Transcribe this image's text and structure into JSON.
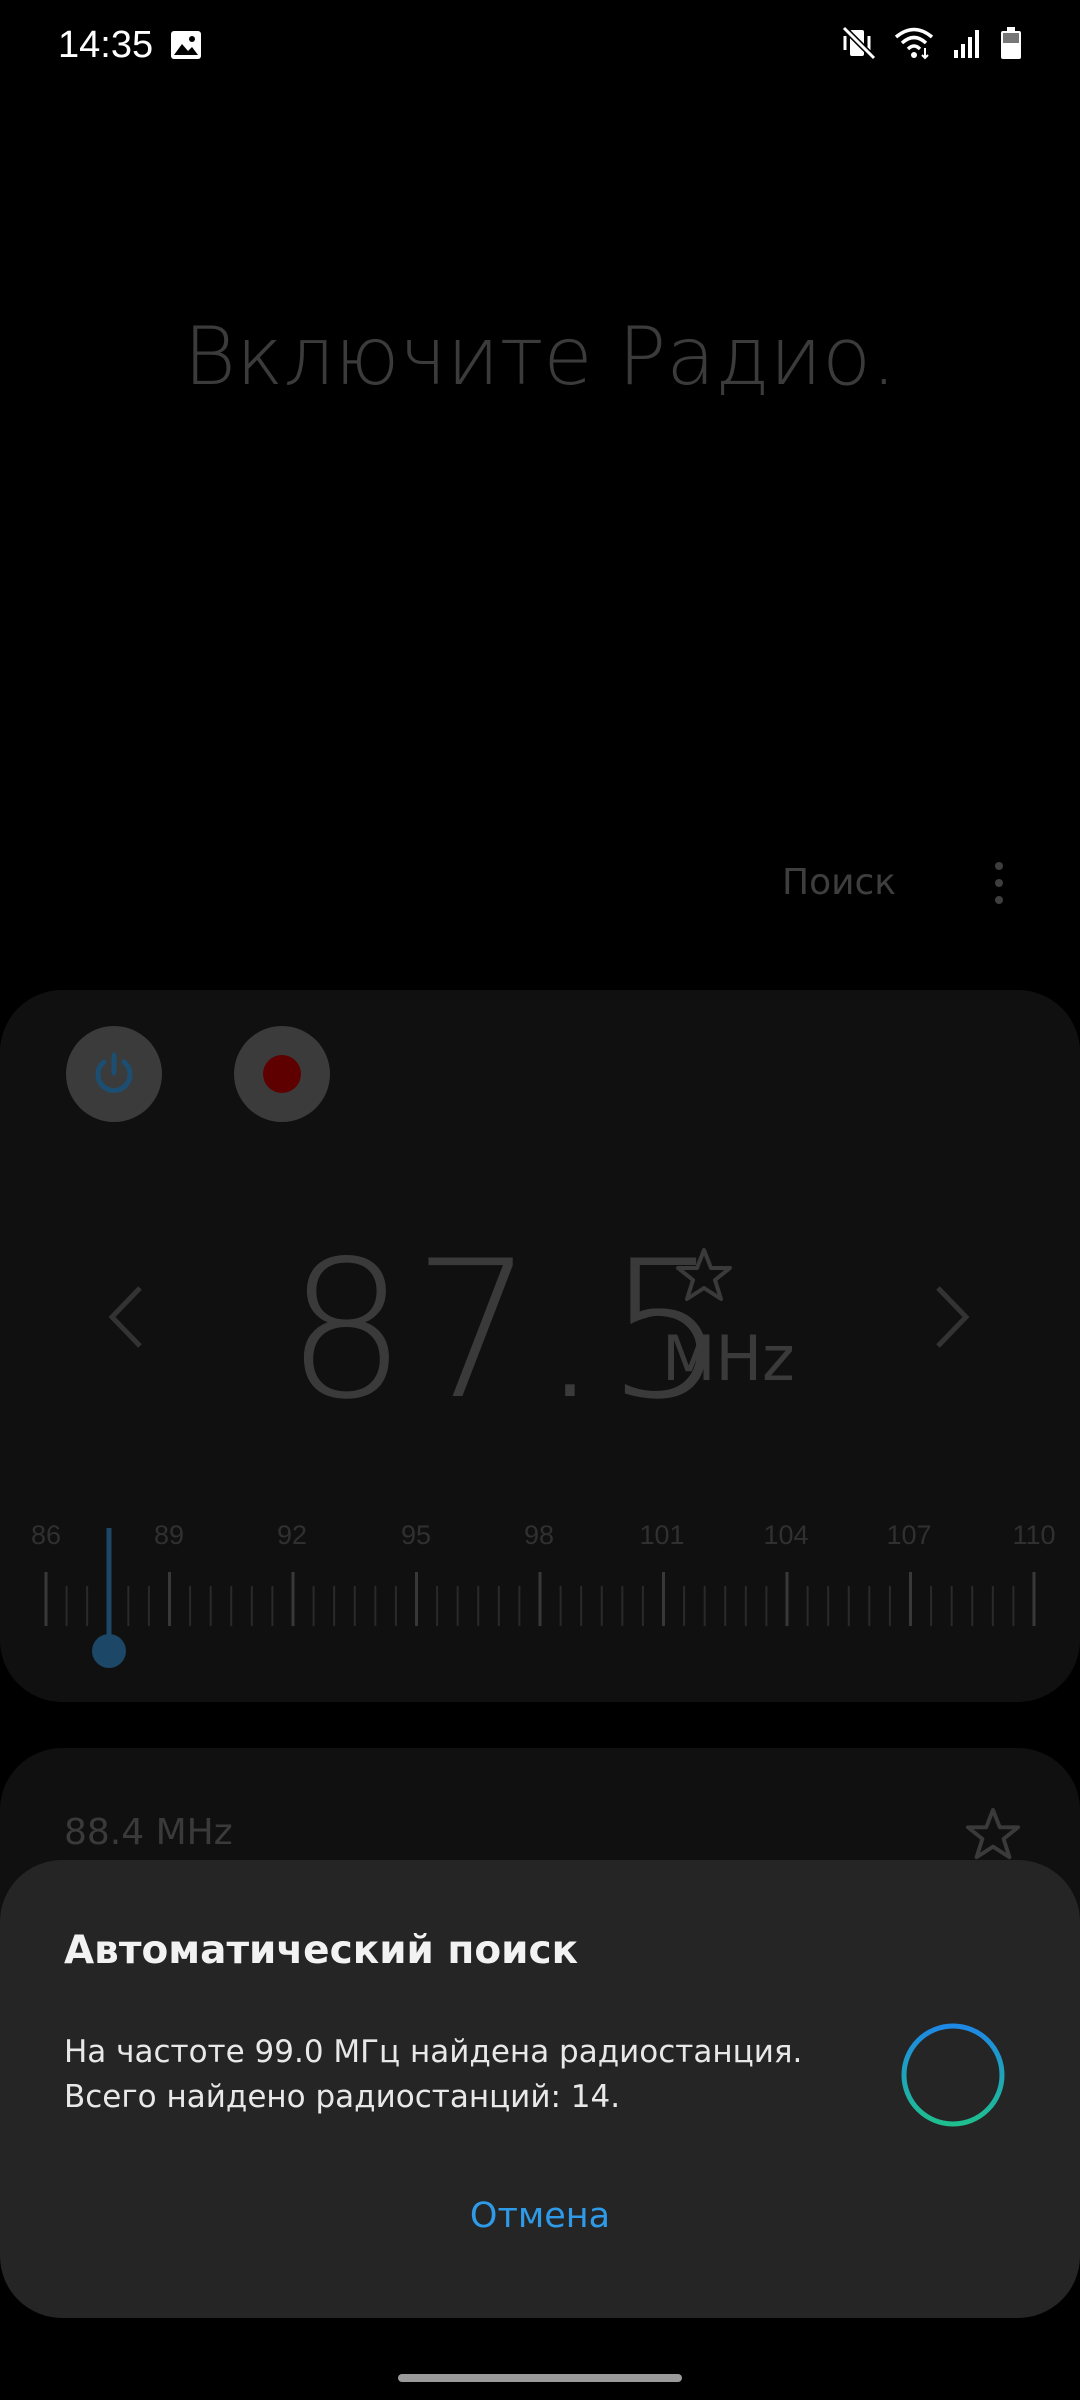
{
  "status_bar": {
    "time": "14:35",
    "icons": [
      "gallery-icon",
      "mute-vibrate-icon",
      "wifi-icon",
      "signal-icon",
      "battery-icon"
    ]
  },
  "radio": {
    "prompt": "Включите Радио.",
    "search_label": "Поиск",
    "frequency": "87.5",
    "unit": "MHz",
    "scale_labels": [
      "86",
      "89",
      "92",
      "95",
      "98",
      "101",
      "104",
      "107",
      "110"
    ],
    "station": "88.4 MHz"
  },
  "dialog": {
    "title": "Автоматический поиск",
    "message": "На частоте 99.0 МГц найдена радиостанция. Всего найдено радиостанций: 14.",
    "cancel_label": "Отмена"
  },
  "colors": {
    "accent": "#2f9ae8",
    "record": "#5e0000",
    "spinner_start": "#1e88e5",
    "spinner_end": "#1fbf8f"
  }
}
